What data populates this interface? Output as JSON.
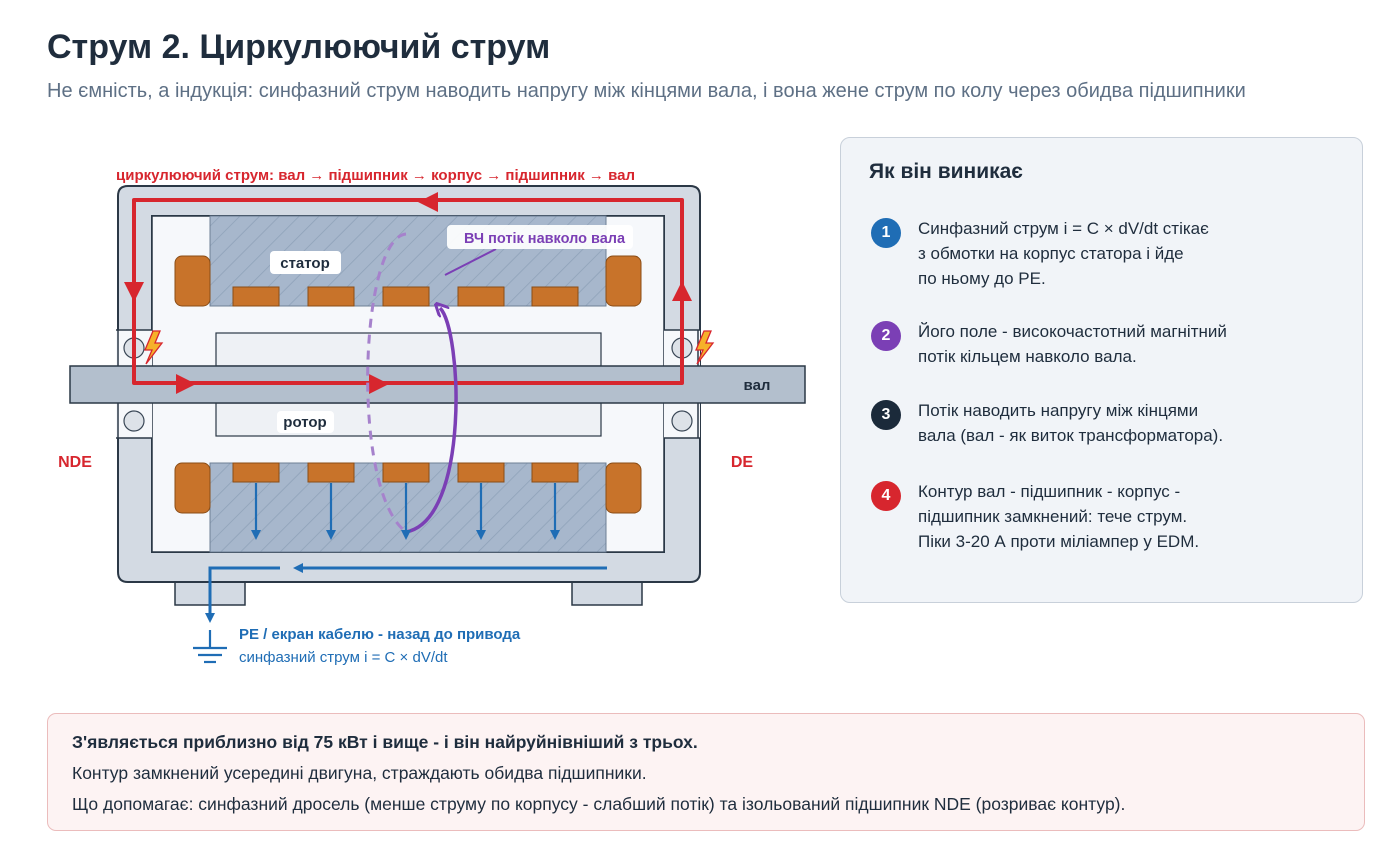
{
  "header": {
    "title": "Струм 2. Циркулюючий струм",
    "subtitle": "Не ємність, а індукція: синфазний струм наводить напругу між кінцями вала, і вона жене струм по колу через обидва підшипники"
  },
  "diagram": {
    "loop_label": "циркулюючий струм: вал → підшипник → корпус → підшипник → вал",
    "flux_label": "ВЧ потік навколо вала",
    "stator_label": "статор",
    "rotor_label": "ротор",
    "shaft_label": "вал",
    "nde_label": "NDE",
    "de_label": "DE",
    "pe_label": "PE / екран кабелю - назад до привода",
    "pe_sub": "синфазний струм i = C × dV/dt",
    "colors": {
      "loop": "#d7262e",
      "flux": "#7b3fb5",
      "pe": "#1f6db5",
      "winding": "#c8732a",
      "core": "#a7b7cc",
      "frame": "#d3dae3"
    }
  },
  "panel": {
    "title": "Як він виникає",
    "steps": [
      {
        "num": "1",
        "color": "#1f6db5",
        "text": "Синфазний струм i = C × dV/dt стікає\nз обмотки на корпус статора і йде\nпо ньому до PE."
      },
      {
        "num": "2",
        "color": "#7b3fb5",
        "text": "Його поле - високочастотний магнітний\nпотік кільцем навколо вала."
      },
      {
        "num": "3",
        "color": "#1b2a3a",
        "text": "Потік наводить напругу між кінцями\nвала (вал - як виток трансформатора)."
      },
      {
        "num": "4",
        "color": "#d7262e",
        "text": "Контур вал - підшипник - корпус -\nпідшипник замкнений: тече струм.\nПіки 3-20 А проти міліампер у EDM."
      }
    ]
  },
  "note": {
    "line1": "З'являється приблизно від 75 кВт і вище - і він найруйнівніший з трьох.",
    "line2": "Контур замкнений усередині двигуна, страждають обидва підшипники.",
    "line3": "Що допомагає: синфазний дросель (менше струму по корпусу - слабший потік) та ізольований підшипник NDE (розриває контур)."
  }
}
